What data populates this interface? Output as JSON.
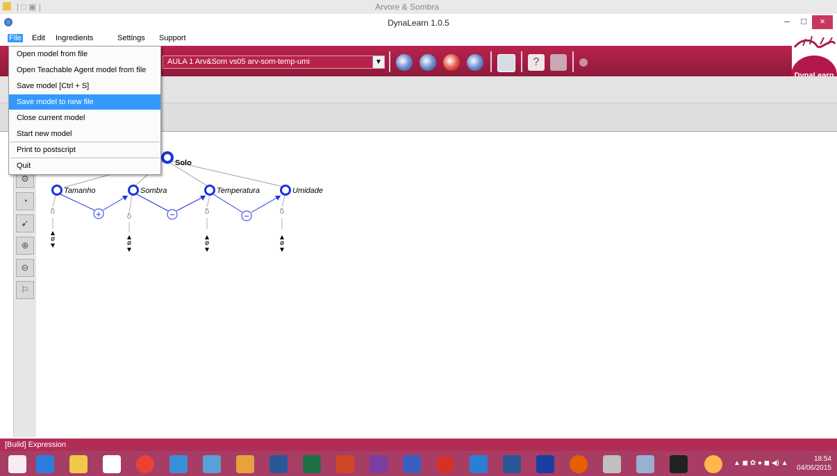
{
  "background_window": {
    "title": "Arvore & Sombra"
  },
  "window": {
    "title": "DynaLearn 1.0.5",
    "minimize": "–",
    "maximize": "□",
    "close": "×"
  },
  "menubar": {
    "items": [
      "File",
      "Edit",
      "Ingredients",
      "Settings",
      "Support"
    ]
  },
  "file_menu": {
    "items": [
      "Open model from file",
      "Open Teachable Agent model from file",
      "Save model [Ctrl + S]",
      "Save model to new file",
      "Close current model",
      "Start new model",
      "Print to postscript",
      "Quit"
    ],
    "highlighted": "Save model to new file"
  },
  "toolbar": {
    "model_select": "AULA 1 Arv&Som vs05 arv-som-temp-umi",
    "logo_text": "DynaLearn"
  },
  "model": {
    "entity": "Solo",
    "quantities": [
      "Tamanho",
      "Sombra",
      "Temperatura",
      "Umidade"
    ],
    "derivative_symbol": "δ",
    "value_symbol": "ø",
    "relations": [
      "+",
      "−",
      "−"
    ]
  },
  "statusbar": {
    "text": "[Build] Expression"
  },
  "taskbar": {
    "time": "18:54",
    "date": "04/06/2015"
  },
  "colors": {
    "brand": "#a61e45",
    "status": "#b22d56",
    "taskbar": "#a73d64",
    "highlight": "#3399ff",
    "node": "#1a33d9"
  }
}
